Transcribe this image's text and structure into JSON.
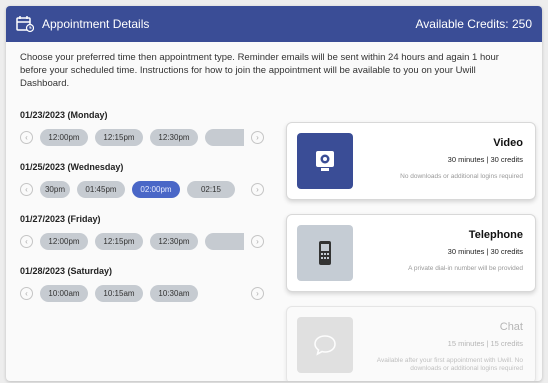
{
  "header": {
    "title": "Appointment Details",
    "credits": "Available Credits: 250",
    "bg_color": "#3a4d96"
  },
  "intro": "Choose your preferred time then appointment type. Reminder emails will be sent within 24 hours and again 1 hour before your scheduled time. Instructions for how to join the appointment will be available to you on your Uwill Dashboard.",
  "days": [
    {
      "label": "01/23/2023 (Monday)",
      "slots": [
        "12:00pm",
        "12:15pm",
        "12:30pm"
      ],
      "selected": null
    },
    {
      "label": "01/25/2023 (Wednesday)",
      "slots": [
        "30pm",
        "01:45pm",
        "02:00pm",
        "02:15"
      ],
      "selected": 2
    },
    {
      "label": "01/27/2023 (Friday)",
      "slots": [
        "12:00pm",
        "12:15pm",
        "12:30pm"
      ],
      "selected": null
    },
    {
      "label": "01/28/2023 (Saturday)",
      "slots": [
        "10:00am",
        "10:15am",
        "10:30am"
      ],
      "selected": null
    }
  ],
  "types": [
    {
      "name": "Video",
      "meta": "30 minutes | 30 credits",
      "note": "No downloads or additional logins required",
      "icon": "video-camera-icon",
      "icon_color": "#3a4d96",
      "disabled": false
    },
    {
      "name": "Telephone",
      "meta": "30 minutes | 30 credits",
      "note": "A private dial-in number will be provided",
      "icon": "phone-icon",
      "icon_color": "#c5ccd4",
      "disabled": false
    },
    {
      "name": "Chat",
      "meta": "15 minutes | 15 credits",
      "note": "Available after your first appointment with Uwill. No downloads or additional logins required",
      "icon": "chat-bubble-icon",
      "icon_color": "#cfcfcf",
      "disabled": true
    }
  ],
  "arrows": {
    "prev": "‹",
    "next": "›"
  }
}
